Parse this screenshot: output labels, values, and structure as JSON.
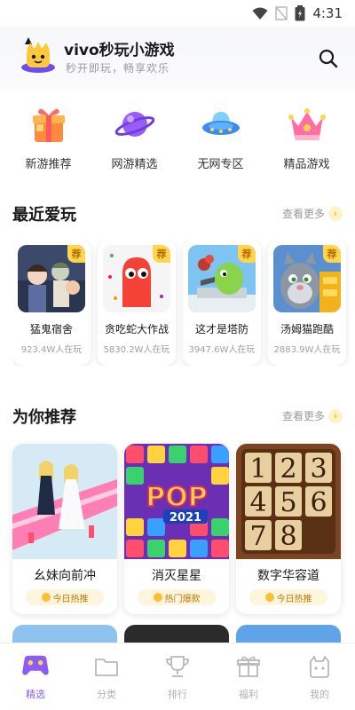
{
  "status_bar": {
    "time": "4:31"
  },
  "header": {
    "brand": "vivo秒玩小游戏",
    "slogan": "秒开即玩，畅享欢乐"
  },
  "categories": [
    {
      "label": "新游推荐",
      "icon": "gift-box-icon"
    },
    {
      "label": "网游精选",
      "icon": "planet-icon"
    },
    {
      "label": "无网专区",
      "icon": "ufo-icon"
    },
    {
      "label": "精品游戏",
      "icon": "crown-icon"
    }
  ],
  "recent": {
    "title": "最近爱玩",
    "more": "查看更多",
    "tag": "荐",
    "items": [
      {
        "name": "猛鬼宿舍",
        "plays": "923.4W人在玩"
      },
      {
        "name": "贪吃蛇大作战",
        "plays": "5830.2W人在玩"
      },
      {
        "name": "这才是塔防",
        "plays": "3947.6W人在玩"
      },
      {
        "name": "汤姆猫跑酷",
        "plays": "2883.9W人在玩"
      }
    ]
  },
  "recommend": {
    "title": "为你推荐",
    "more": "查看更多",
    "items": [
      {
        "name": "幺妹向前冲",
        "badge": "今日热推"
      },
      {
        "name": "消灭星星",
        "badge": "热门爆款"
      },
      {
        "name": "数字华容道",
        "badge": "今日热推"
      }
    ],
    "pop_text": "POP",
    "pop_year": "2021",
    "puzzle_numbers": [
      "1",
      "2",
      "3",
      "4",
      "5",
      "6",
      "7",
      "8"
    ]
  },
  "bottom_nav": [
    {
      "label": "精选",
      "icon": "gamepad-icon",
      "active": true
    },
    {
      "label": "分类",
      "icon": "folder-icon",
      "active": false
    },
    {
      "label": "排行",
      "icon": "trophy-icon",
      "active": false
    },
    {
      "label": "福利",
      "icon": "gift-icon",
      "active": false
    },
    {
      "label": "我的",
      "icon": "profile-icon",
      "active": false
    }
  ],
  "colors": {
    "accent": "#8b5cf6",
    "tag": "#ffd54a",
    "hot_badge_bg": "#fff5dc",
    "muted": "#9a9a9a"
  }
}
